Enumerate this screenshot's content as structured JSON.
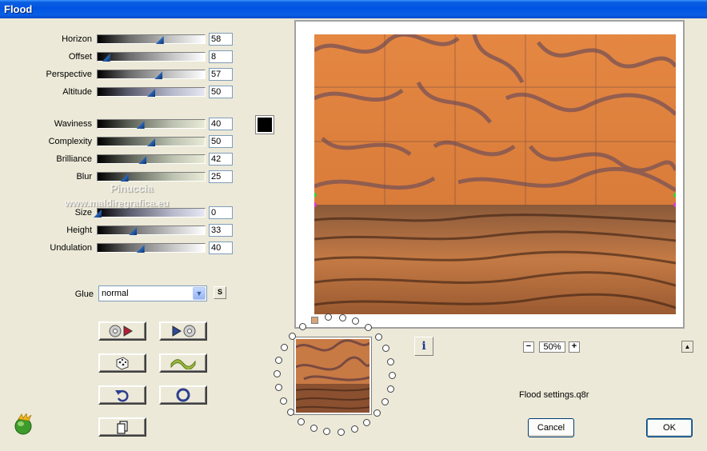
{
  "window": {
    "title": "Flood"
  },
  "sliders_group1": [
    {
      "label": "Horizon",
      "value": "58",
      "fraction": 0.58,
      "style": "gray"
    },
    {
      "label": "Offset",
      "value": "8",
      "fraction": 0.08,
      "style": "gray"
    },
    {
      "label": "Perspective",
      "value": "57",
      "fraction": 0.57,
      "style": "gray"
    },
    {
      "label": "Altitude",
      "value": "50",
      "fraction": 0.5,
      "style": "blue"
    }
  ],
  "sliders_group2": [
    {
      "label": "Waviness",
      "value": "40",
      "fraction": 0.4,
      "style": "green"
    },
    {
      "label": "Complexity",
      "value": "50",
      "fraction": 0.5,
      "style": "green"
    },
    {
      "label": "Brilliance",
      "value": "42",
      "fraction": 0.42,
      "style": "green"
    },
    {
      "label": "Blur",
      "value": "25",
      "fraction": 0.25,
      "style": "green"
    }
  ],
  "sliders_group3": [
    {
      "label": "Size",
      "value": "0",
      "fraction": 0.0,
      "style": "blue"
    },
    {
      "label": "Height",
      "value": "33",
      "fraction": 0.33,
      "style": "gray"
    },
    {
      "label": "Undulation",
      "value": "40",
      "fraction": 0.4,
      "style": "gray"
    }
  ],
  "color_swatch": "#000000",
  "watermark": {
    "line1": "Pinuccia",
    "line2": "www.maldiregrafica.eu"
  },
  "glue": {
    "label": "Glue",
    "value": "normal",
    "s_button": "S"
  },
  "buttons": {
    "prev_preset": "prev-preset-icon",
    "next_preset": "next-preset-icon",
    "random": "dice-icon",
    "wave": "wave-icon",
    "undo": "undo-icon",
    "reset": "reset-icon",
    "copy": "copy-icon"
  },
  "zoom": {
    "minus": "−",
    "value": "50%",
    "plus": "+"
  },
  "info_button": "i",
  "collapse_button": "▲",
  "settings_file": "Flood settings.q8r",
  "dialog": {
    "cancel": "Cancel",
    "ok": "OK"
  },
  "colors": {
    "titlebar": "#0054e3",
    "face": "#ece9d8",
    "water": "#e07a35"
  }
}
